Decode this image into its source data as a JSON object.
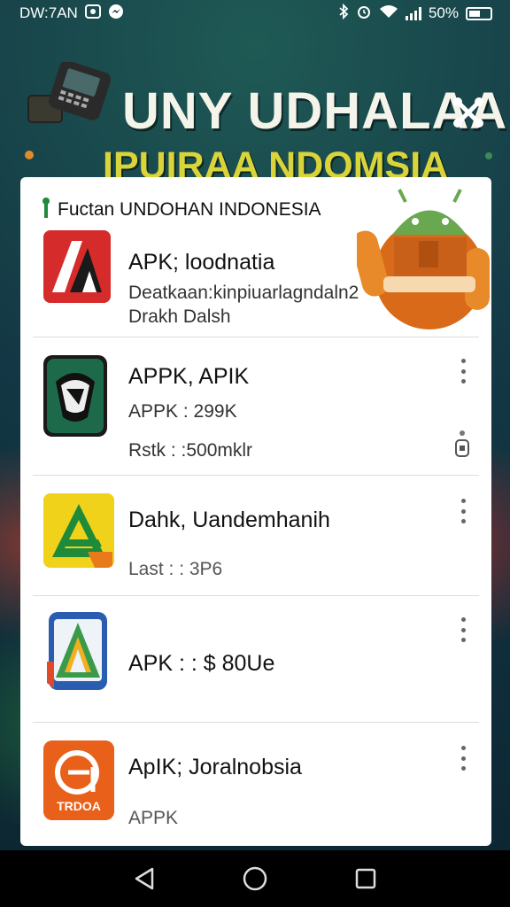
{
  "status_bar": {
    "time": "DW:7AN",
    "battery": "50%",
    "icons": [
      "gallery-icon",
      "messenger-icon",
      "bluetooth-icon",
      "alarm-icon",
      "wifi-icon",
      "signal-icon",
      "battery-icon"
    ]
  },
  "banner": {
    "title_line1": "UNY UDHALAA",
    "title_line2": "IPUIRAA NDOMSIA",
    "share_icon": "share-icon",
    "colors": {
      "title1": "#f4f4ea",
      "title2": "#d9d43a"
    }
  },
  "card": {
    "header": "Fuctan UNDOHAN INDONESIA",
    "apps": [
      {
        "name": "APK; loodnatia",
        "lines": [
          "Deatkaan:kinpiuarlagndaln2",
          "Drakh Dalsh"
        ],
        "icon": "aa-red-app-icon",
        "has_menu": false
      },
      {
        "name": "APPK, APIK",
        "lines": [
          "APPK : 299K",
          "Rstk : :500mklr"
        ],
        "icon": "shield-phone-app-icon",
        "has_menu": true,
        "extra_icon": "lock-icon"
      },
      {
        "name": "Dahk, Uandemhanih",
        "lines": [
          "Last : : 3P6"
        ],
        "icon": "a-yellow-app-icon",
        "has_menu": true
      },
      {
        "name": "APK : : $ 80Ue",
        "lines": [],
        "icon": "a-blue-app-icon",
        "has_menu": true
      },
      {
        "name": "ApIK; Joralnobsia",
        "lines": [
          "APPK"
        ],
        "icon": "orange-app-icon",
        "icon_text": "TRDOA",
        "has_menu": true
      }
    ]
  },
  "nav_bar": {
    "buttons": [
      "back-icon",
      "home-icon",
      "recents-icon"
    ]
  }
}
